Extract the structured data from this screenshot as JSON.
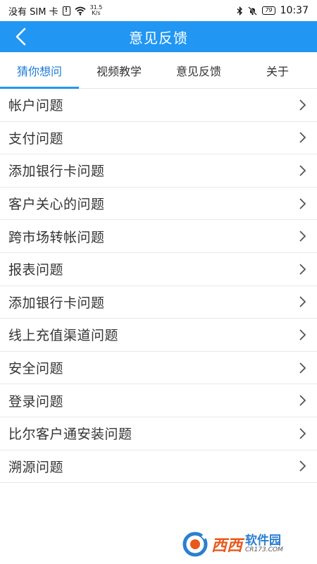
{
  "status_bar": {
    "carrier": "没有 SIM 卡",
    "speed_value": "31.5",
    "speed_unit": "K/s",
    "battery": "79",
    "time": "10:37"
  },
  "header": {
    "title": "意见反馈",
    "back_icon": "chevron-left-icon",
    "background_color": "#2196f3"
  },
  "tabs": [
    {
      "label": "猜你想问",
      "active": true
    },
    {
      "label": "视频教学",
      "active": false
    },
    {
      "label": "意见反馈",
      "active": false
    },
    {
      "label": "关于",
      "active": false
    }
  ],
  "faq_items": [
    {
      "label": "帐户问题"
    },
    {
      "label": "支付问题"
    },
    {
      "label": "添加银行卡问题"
    },
    {
      "label": "客户关心的问题"
    },
    {
      "label": "跨市场转帐问题"
    },
    {
      "label": "报表问题"
    },
    {
      "label": "添加银行卡问题"
    },
    {
      "label": "线上充值渠道问题"
    },
    {
      "label": "安全问题"
    },
    {
      "label": "登录问题"
    },
    {
      "label": "比尔客户通安装问题"
    },
    {
      "label": "溯源问题"
    }
  ],
  "watermark": {
    "brand": "西西",
    "brand_cn": "软件园",
    "url": "CR173.COM"
  }
}
